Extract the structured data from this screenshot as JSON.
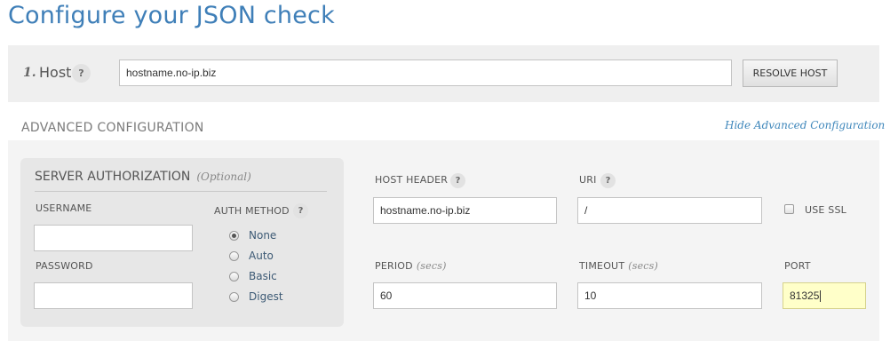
{
  "page_title": "Configure your JSON check",
  "host": {
    "step_number": "1.",
    "label": "Host",
    "help": "?",
    "value": "hostname.no-ip.biz",
    "resolve_button": "RESOLVE HOST"
  },
  "advanced": {
    "title": "ADVANCED CONFIGURATION",
    "toggle_link": "Hide Advanced Configuration"
  },
  "server_auth": {
    "title": "SERVER AUTHORIZATION",
    "optional": "(Optional)",
    "username_label": "USERNAME",
    "username_value": "",
    "password_label": "PASSWORD",
    "password_value": "",
    "auth_method_label": "AUTH METHOD",
    "auth_method_help": "?",
    "auth_methods": [
      {
        "label": "None",
        "selected": true
      },
      {
        "label": "Auto",
        "selected": false
      },
      {
        "label": "Basic",
        "selected": false
      },
      {
        "label": "Digest",
        "selected": false
      }
    ]
  },
  "fields": {
    "host_header_label": "HOST HEADER",
    "host_header_help": "?",
    "host_header_value": "hostname.no-ip.biz",
    "uri_label": "URI",
    "uri_help": "?",
    "uri_value": "/",
    "use_ssl_label": "USE SSL",
    "use_ssl_checked": false,
    "period_label": "PERIOD",
    "period_unit": "(secs)",
    "period_value": "60",
    "timeout_label": "TIMEOUT",
    "timeout_unit": "(secs)",
    "timeout_value": "10",
    "port_label": "PORT",
    "port_value": "81325"
  },
  "colors": {
    "title_blue": "#3f7fb8",
    "link_blue": "#3f87bb",
    "focus_yellow": "#ffffc9"
  }
}
